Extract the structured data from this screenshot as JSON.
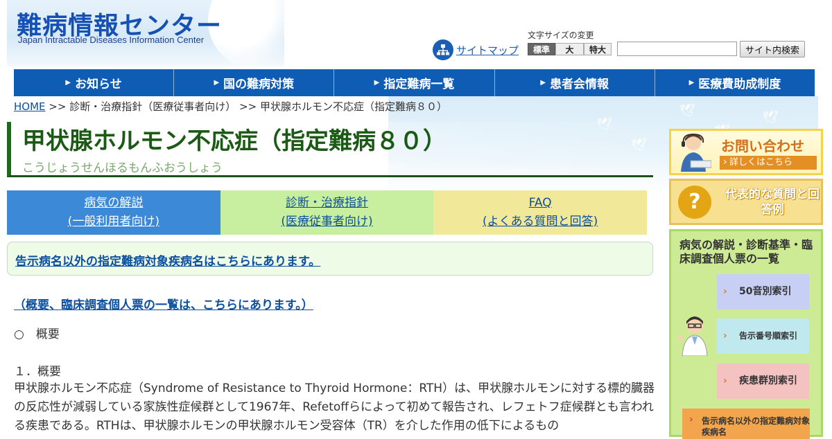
{
  "header": {
    "logo_ja": "難病情報センター",
    "logo_en": "Japan Intractable Diseases Information Center",
    "sitemap_label": "サイトマップ",
    "fontsize_label": "文字サイズの変更",
    "fontsize_options": [
      "標準",
      "大",
      "特大"
    ],
    "fontsize_selected": "標準",
    "search_value": "",
    "search_button": "サイト内検索"
  },
  "nav": {
    "items": [
      {
        "label": "お知らせ"
      },
      {
        "label": "国の難病対策"
      },
      {
        "label": "指定難病一覧"
      },
      {
        "label": "患者会情報"
      },
      {
        "label": "医療費助成制度"
      }
    ]
  },
  "breadcrumb": {
    "home": "HOME",
    "sep": ">>",
    "level1": "診断・治療指針（医療従事者向け）",
    "current": "甲状腺ホルモン不応症（指定難病８０）"
  },
  "title": {
    "main": "甲状腺ホルモン不応症（指定難病８０）",
    "reading": "こうじょうせんほるもんふおうしょう"
  },
  "tabs": [
    {
      "line1": "病気の解説",
      "line2": "(一般利用者向け)"
    },
    {
      "line1": "診断・治療指針",
      "line2": "(医療従事者向け)"
    },
    {
      "line1": "FAQ",
      "line2": "(よくある質問と回答)"
    }
  ],
  "content": {
    "notice_link": "告示病名以外の指定難病対象疾病名はこちらにあります。",
    "overview_link": "（概要、臨床調査個人票の一覧は、こちらにあります。）",
    "section_heading": "○　概要",
    "sub_heading": "１．概要",
    "body": "甲状腺ホルモン不応症（Syndrome of Resistance to Thyroid Hormone：RTH）は、甲状腺ホルモンに対する標的臓器の反応性が減弱している家族性症候群として1967年、Refetoffらによって初めて報告され、レフェトフ症候群とも言われる疾患である。RTHは、甲状腺ホルモンの甲状腺ホルモン受容体（TR）を介した作用の低下によるもの"
  },
  "sidebar": {
    "contact_title": "お問い合わせ",
    "contact_detail": "詳しくはこちら",
    "faq_banner": "代表的な質問と回答例",
    "index_title": "病気の解説・診断基準・臨床調査個人票の一覧",
    "index_kana": "50音別索引",
    "index_number": "告示番号順索引",
    "index_group": "疾患群別索引",
    "index_other": "告示病名以外の指定難病対象疾病名",
    "colors": {
      "contact_accent": "#d36f1a",
      "index_bg": "#cdeb94"
    }
  },
  "colors": {
    "nav_bg": "#0f5cb5",
    "title_green": "#1b5a14",
    "link": "#0b4f9e"
  }
}
